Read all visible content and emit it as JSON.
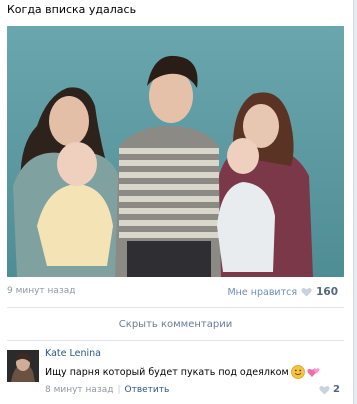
{
  "post": {
    "text": "Когда вписка удалась",
    "time": "9 минут назад",
    "like_label": "Мне нравится",
    "like_count": "160"
  },
  "comments_toggle": "Скрыть комментарии",
  "comment": {
    "author": "Kate Lenina",
    "text": "Ищу парня который будет пукать под одеялком",
    "time": "8 минут назад",
    "reply_label": "Ответить",
    "like_count": "2"
  },
  "colors": {
    "link": "#2a5885",
    "meta": "#8f98a3",
    "heart": "#c9d3de",
    "photo_wall": "#5e9ba2"
  }
}
